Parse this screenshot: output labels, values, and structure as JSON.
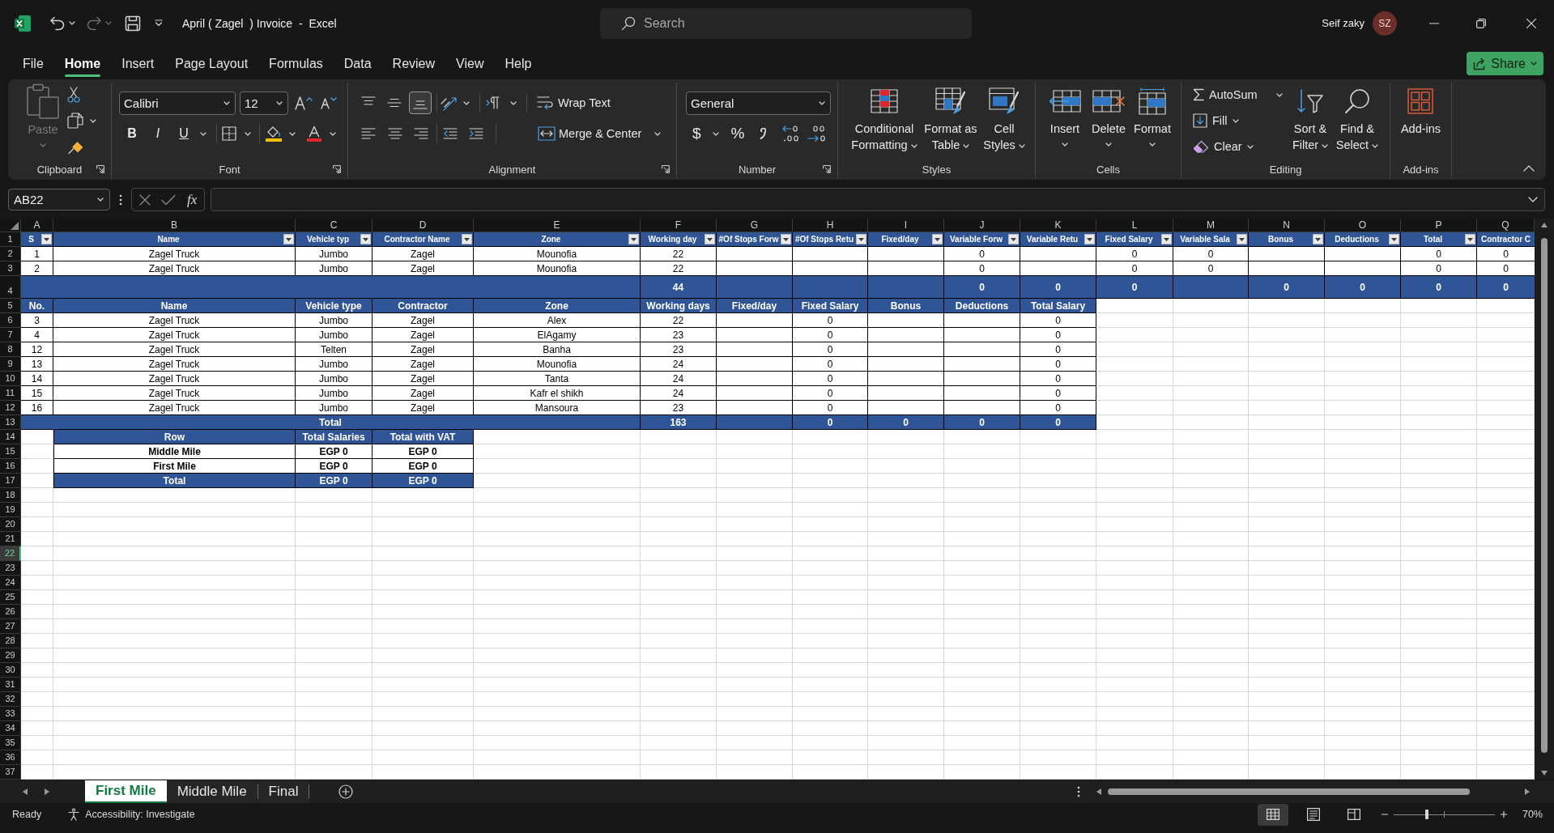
{
  "window": {
    "title": "April ( Zagel  ) Invoice  -  Excel",
    "user_name": "Seif zaky",
    "avatar_initials": "SZ"
  },
  "quick_access": {
    "undo_disabled": false,
    "redo_disabled": true
  },
  "search": {
    "placeholder": "Search"
  },
  "menu_tabs": [
    {
      "label": "File",
      "selected": false
    },
    {
      "label": "Home",
      "selected": true
    },
    {
      "label": "Insert",
      "selected": false
    },
    {
      "label": "Page Layout",
      "selected": false
    },
    {
      "label": "Formulas",
      "selected": false
    },
    {
      "label": "Data",
      "selected": false
    },
    {
      "label": "Review",
      "selected": false
    },
    {
      "label": "View",
      "selected": false
    },
    {
      "label": "Help",
      "selected": false
    }
  ],
  "share_button": {
    "label": "Share"
  },
  "ribbon": {
    "groups": [
      {
        "kind": "clipboard",
        "label": "Clipboard",
        "paste": {
          "label": "Paste",
          "disabled": true
        }
      },
      {
        "kind": "font",
        "label": "Font",
        "font_name": "Calibri",
        "font_size": "12",
        "styles": [
          "B",
          "I",
          "U"
        ]
      },
      {
        "kind": "alignment",
        "label": "Alignment",
        "vertical_align": [
          {
            "selected": false
          },
          {
            "selected": false
          },
          {
            "selected": true
          }
        ],
        "wrap_text": "Wrap Text",
        "merge_center": "Merge & Center"
      },
      {
        "kind": "number",
        "label": "Number",
        "format": "General",
        "currency": "$",
        "percent": "%"
      },
      {
        "kind": "styles",
        "label": "Styles",
        "buttons": [
          "Conditional Formatting",
          "Format as Table",
          "Cell Styles"
        ]
      },
      {
        "kind": "cells",
        "label": "Cells",
        "buttons": [
          "Insert",
          "Delete",
          "Format"
        ]
      },
      {
        "kind": "editing",
        "label": "Editing",
        "small_buttons": [
          "AutoSum",
          "Fill",
          "Clear"
        ],
        "buttons": [
          "Sort & Filter",
          "Find & Select"
        ]
      },
      {
        "kind": "add_ins",
        "label": "Add-ins",
        "buttons": [
          "Add-ins"
        ]
      }
    ]
  },
  "formula_bar": {
    "name_box": "AB22",
    "function_label": "fx"
  },
  "sheet": {
    "column_headers": [
      "A",
      "B",
      "C",
      "D",
      "E",
      "F",
      "G",
      "H",
      "I",
      "J",
      "K",
      "L",
      "M",
      "N",
      "O",
      "P",
      "Q"
    ],
    "row_headers": [
      {
        "label": "1",
        "selected": false
      },
      {
        "label": "2",
        "selected": false
      },
      {
        "label": "3",
        "selected": false
      },
      {
        "label": "4",
        "selected": false
      },
      {
        "label": "5",
        "selected": false
      },
      {
        "label": "6",
        "selected": false
      },
      {
        "label": "7",
        "selected": false
      },
      {
        "label": "8",
        "selected": false
      },
      {
        "label": "9",
        "selected": false
      },
      {
        "label": "10",
        "selected": false
      },
      {
        "label": "11",
        "selected": false
      },
      {
        "label": "12",
        "selected": false
      },
      {
        "label": "13",
        "selected": false
      },
      {
        "label": "14",
        "selected": false
      },
      {
        "label": "15",
        "selected": false
      },
      {
        "label": "16",
        "selected": false
      },
      {
        "label": "17",
        "selected": false
      },
      {
        "label": "18",
        "selected": false
      },
      {
        "label": "19",
        "selected": false
      },
      {
        "label": "20",
        "selected": false
      },
      {
        "label": "21",
        "selected": false
      },
      {
        "label": "22",
        "selected": true
      },
      {
        "label": "23",
        "selected": false
      },
      {
        "label": "24",
        "selected": false
      },
      {
        "label": "25",
        "selected": false
      },
      {
        "label": "26",
        "selected": false
      },
      {
        "label": "27",
        "selected": false
      },
      {
        "label": "28",
        "selected": false
      },
      {
        "label": "29",
        "selected": false
      },
      {
        "label": "30",
        "selected": false
      },
      {
        "label": "31",
        "selected": false
      },
      {
        "label": "32",
        "selected": false
      },
      {
        "label": "33",
        "selected": false
      },
      {
        "label": "34",
        "selected": false
      },
      {
        "label": "35",
        "selected": false
      },
      {
        "label": "36",
        "selected": false
      },
      {
        "label": "37",
        "selected": false
      }
    ],
    "rows": [
      {
        "kind": "header",
        "merged_label": false,
        "cells": [
          {
            "text": "S",
            "filter": true,
            "in_table": true
          },
          {
            "text": "Name",
            "filter": true,
            "in_table": true
          },
          {
            "text": "Vehicle typ",
            "filter": true,
            "in_table": true
          },
          {
            "text": "Contractor Name",
            "filter": true,
            "in_table": true
          },
          {
            "text": "Zone",
            "filter": true,
            "in_table": true
          },
          {
            "text": "Working day",
            "filter": true,
            "in_table": true
          },
          {
            "text": "#Of Stops Forw",
            "filter": true,
            "in_table": true
          },
          {
            "text": "#Of Stops Retu",
            "filter": true,
            "in_table": true
          },
          {
            "text": "Fixed/day",
            "filter": true,
            "in_table": true
          },
          {
            "text": "Variable Forw",
            "filter": true,
            "in_table": true
          },
          {
            "text": "Variable Retu",
            "filter": true,
            "in_table": true
          },
          {
            "text": "Fixed Salary",
            "filter": true,
            "in_table": true
          },
          {
            "text": "Variable Sala",
            "filter": true,
            "in_table": true
          },
          {
            "text": "Bonus",
            "filter": true,
            "in_table": true
          },
          {
            "text": "Deductions",
            "filter": true,
            "in_table": true
          },
          {
            "text": "Total",
            "filter": true,
            "in_table": true
          },
          {
            "text": "Contractor C",
            "filter": false,
            "in_table": true
          }
        ]
      },
      {
        "kind": "data",
        "merged_label": false,
        "cells": [
          {
            "text": "1",
            "in_table": true
          },
          {
            "text": "Zagel Truck",
            "in_table": true
          },
          {
            "text": "Jumbo",
            "in_table": true
          },
          {
            "text": "Zagel",
            "in_table": true
          },
          {
            "text": "Mounofia",
            "in_table": true
          },
          {
            "text": "22",
            "in_table": true
          },
          {
            "in_table": true
          },
          {
            "in_table": true
          },
          {
            "in_table": true
          },
          {
            "text": "0",
            "in_table": true
          },
          {
            "in_table": true
          },
          {
            "text": "0",
            "in_table": true
          },
          {
            "text": "0",
            "in_table": true
          },
          {
            "in_table": true
          },
          {
            "in_table": true
          },
          {
            "text": "0",
            "in_table": true
          },
          {
            "text": "0",
            "in_table": true
          }
        ]
      },
      {
        "kind": "data",
        "merged_label": false,
        "cells": [
          {
            "text": "2",
            "in_table": true
          },
          {
            "text": "Zagel Truck",
            "in_table": true
          },
          {
            "text": "Jumbo",
            "in_table": true
          },
          {
            "text": "Zagel",
            "in_table": true
          },
          {
            "text": "Mounofia",
            "in_table": true
          },
          {
            "text": "22",
            "in_table": true
          },
          {
            "in_table": true
          },
          {
            "in_table": true
          },
          {
            "in_table": true
          },
          {
            "text": "0",
            "in_table": true
          },
          {
            "in_table": true
          },
          {
            "text": "0",
            "in_table": true
          },
          {
            "text": "0",
            "in_table": true
          },
          {
            "in_table": true
          },
          {
            "in_table": true
          },
          {
            "text": "0",
            "in_table": true
          },
          {
            "text": "0",
            "in_table": true
          }
        ]
      },
      {
        "kind": "total",
        "merged_label": true,
        "cells": [
          {
            "in_table": true
          },
          {
            "in_table": true
          },
          {
            "in_table": true
          },
          {
            "in_table": true
          },
          {
            "in_table": true
          },
          {
            "text": "44",
            "in_table": true
          },
          {
            "in_table": true
          },
          {
            "in_table": true
          },
          {
            "in_table": true
          },
          {
            "text": "0",
            "in_table": true
          },
          {
            "text": "0",
            "in_table": true
          },
          {
            "text": "0",
            "in_table": true
          },
          {
            "in_table": true
          },
          {
            "text": "0",
            "in_table": true
          },
          {
            "text": "0",
            "in_table": true
          },
          {
            "text": "0",
            "in_table": true
          },
          {
            "text": "0",
            "in_table": true
          }
        ]
      },
      {
        "kind": "header",
        "merged_label": false,
        "cells": [
          {
            "text": "No.",
            "in_table": true
          },
          {
            "text": "Name",
            "in_table": true
          },
          {
            "text": "Vehicle type",
            "in_table": true
          },
          {
            "text": "Contractor",
            "in_table": true
          },
          {
            "text": "Zone",
            "in_table": true
          },
          {
            "text": "Working days",
            "in_table": true
          },
          {
            "text": "Fixed/day",
            "in_table": true
          },
          {
            "text": "Fixed Salary",
            "in_table": true
          },
          {
            "text": "Bonus",
            "in_table": true
          },
          {
            "text": "Deductions",
            "in_table": true
          },
          {
            "text": "Total Salary",
            "in_table": true
          }
        ]
      },
      {
        "kind": "data",
        "merged_label": false,
        "cells": [
          {
            "text": "3",
            "in_table": true
          },
          {
            "text": "Zagel Truck",
            "in_table": true
          },
          {
            "text": "Jumbo",
            "in_table": true
          },
          {
            "text": "Zagel",
            "in_table": true
          },
          {
            "text": "Alex",
            "in_table": true
          },
          {
            "text": "22",
            "in_table": true
          },
          {
            "in_table": true
          },
          {
            "text": "0",
            "in_table": true
          },
          {
            "in_table": true
          },
          {
            "in_table": true
          },
          {
            "text": "0",
            "in_table": true
          }
        ]
      },
      {
        "kind": "data",
        "merged_label": false,
        "cells": [
          {
            "text": "4",
            "in_table": true
          },
          {
            "text": "Zagel Truck",
            "in_table": true
          },
          {
            "text": "Jumbo",
            "in_table": true
          },
          {
            "text": "Zagel",
            "in_table": true
          },
          {
            "text": "ElAgamy",
            "in_table": true
          },
          {
            "text": "23",
            "in_table": true
          },
          {
            "in_table": true
          },
          {
            "text": "0",
            "in_table": true
          },
          {
            "in_table": true
          },
          {
            "in_table": true
          },
          {
            "text": "0",
            "in_table": true
          }
        ]
      },
      {
        "kind": "data",
        "merged_label": false,
        "cells": [
          {
            "text": "12",
            "in_table": true
          },
          {
            "text": "Zagel Truck",
            "in_table": true
          },
          {
            "text": "Telten",
            "in_table": true
          },
          {
            "text": "Zagel",
            "in_table": true
          },
          {
            "text": "Banha",
            "in_table": true
          },
          {
            "text": "23",
            "in_table": true
          },
          {
            "in_table": true
          },
          {
            "text": "0",
            "in_table": true
          },
          {
            "in_table": true
          },
          {
            "in_table": true
          },
          {
            "text": "0",
            "in_table": true
          }
        ]
      },
      {
        "kind": "data",
        "merged_label": false,
        "cells": [
          {
            "text": "13",
            "in_table": true
          },
          {
            "text": "Zagel Truck",
            "in_table": true
          },
          {
            "text": "Jumbo",
            "in_table": true
          },
          {
            "text": "Zagel",
            "in_table": true
          },
          {
            "text": "Mounofia",
            "in_table": true
          },
          {
            "text": "24",
            "in_table": true
          },
          {
            "in_table": true
          },
          {
            "text": "0",
            "in_table": true
          },
          {
            "in_table": true
          },
          {
            "in_table": true
          },
          {
            "text": "0",
            "in_table": true
          }
        ]
      },
      {
        "kind": "data",
        "merged_label": false,
        "cells": [
          {
            "text": "14",
            "in_table": true
          },
          {
            "text": "Zagel Truck",
            "in_table": true
          },
          {
            "text": "Jumbo",
            "in_table": true
          },
          {
            "text": "Zagel",
            "in_table": true
          },
          {
            "text": "Tanta",
            "in_table": true
          },
          {
            "text": "24",
            "in_table": true
          },
          {
            "in_table": true
          },
          {
            "text": "0",
            "in_table": true
          },
          {
            "in_table": true
          },
          {
            "in_table": true
          },
          {
            "text": "0",
            "in_table": true
          }
        ]
      },
      {
        "kind": "data",
        "merged_label": false,
        "cells": [
          {
            "text": "15",
            "in_table": true
          },
          {
            "text": "Zagel Truck",
            "in_table": true
          },
          {
            "text": "Jumbo",
            "in_table": true
          },
          {
            "text": "Zagel",
            "in_table": true
          },
          {
            "text": "Kafr el shikh",
            "in_table": true
          },
          {
            "text": "24",
            "in_table": true
          },
          {
            "in_table": true
          },
          {
            "text": "0",
            "in_table": true
          },
          {
            "in_table": true
          },
          {
            "in_table": true
          },
          {
            "text": "0",
            "in_table": true
          }
        ]
      },
      {
        "kind": "data",
        "merged_label": false,
        "cells": [
          {
            "text": "16",
            "in_table": true
          },
          {
            "text": "Zagel Truck",
            "in_table": true
          },
          {
            "text": "Jumbo",
            "in_table": true
          },
          {
            "text": "Zagel",
            "in_table": true
          },
          {
            "text": "Mansoura",
            "in_table": true
          },
          {
            "text": "23",
            "in_table": true
          },
          {
            "in_table": true
          },
          {
            "text": "0",
            "in_table": true
          },
          {
            "in_table": true
          },
          {
            "in_table": true
          },
          {
            "text": "0",
            "in_table": true
          }
        ]
      },
      {
        "kind": "total",
        "merged_label": true,
        "cells": [
          {
            "in_table": true
          },
          {
            "in_table": true
          },
          {
            "text": "Total",
            "in_table": true
          },
          {
            "in_table": true
          },
          {
            "in_table": true
          },
          {
            "text": "163",
            "in_table": true
          },
          {
            "in_table": true
          },
          {
            "text": "0",
            "in_table": true
          },
          {
            "text": "0",
            "in_table": true
          },
          {
            "text": "0",
            "in_table": true
          },
          {
            "text": "0",
            "in_table": true
          }
        ]
      },
      {
        "kind": "header",
        "merged_label": false,
        "cells": [
          {
            "in_table": false
          },
          {
            "text": "Row",
            "in_table": true
          },
          {
            "text": "Total Salaries",
            "in_table": true
          },
          {
            "text": "Total with VAT",
            "in_table": true
          }
        ]
      },
      {
        "kind": "bold_data",
        "merged_label": false,
        "cells": [
          {
            "in_table": false
          },
          {
            "text": "Middle Mile",
            "in_table": true
          },
          {
            "text": "EGP 0",
            "in_table": true
          },
          {
            "text": "EGP 0",
            "in_table": true
          }
        ]
      },
      {
        "kind": "bold_data",
        "merged_label": false,
        "cells": [
          {
            "in_table": false
          },
          {
            "text": "First Mile",
            "in_table": true
          },
          {
            "text": "EGP 0",
            "in_table": true
          },
          {
            "text": "EGP 0",
            "in_table": true
          }
        ]
      },
      {
        "kind": "total",
        "merged_label": false,
        "cells": [
          {
            "in_table": false
          },
          {
            "text": "Total",
            "in_table": true
          },
          {
            "text": "EGP 0",
            "in_table": true
          },
          {
            "text": "EGP 0",
            "in_table": true
          }
        ]
      }
    ]
  },
  "sheet_tabs": [
    {
      "label": "First Mile",
      "selected": true
    },
    {
      "label": "Middle Mile",
      "selected": false
    },
    {
      "label": "Final",
      "selected": false
    }
  ],
  "status_bar": {
    "status": "Ready",
    "accessibility": "Accessibility: Investigate",
    "views": [
      {
        "selected": true
      },
      {
        "selected": false
      },
      {
        "selected": false
      }
    ],
    "zoom": {
      "level": 0.33,
      "reading": "70%"
    }
  }
}
